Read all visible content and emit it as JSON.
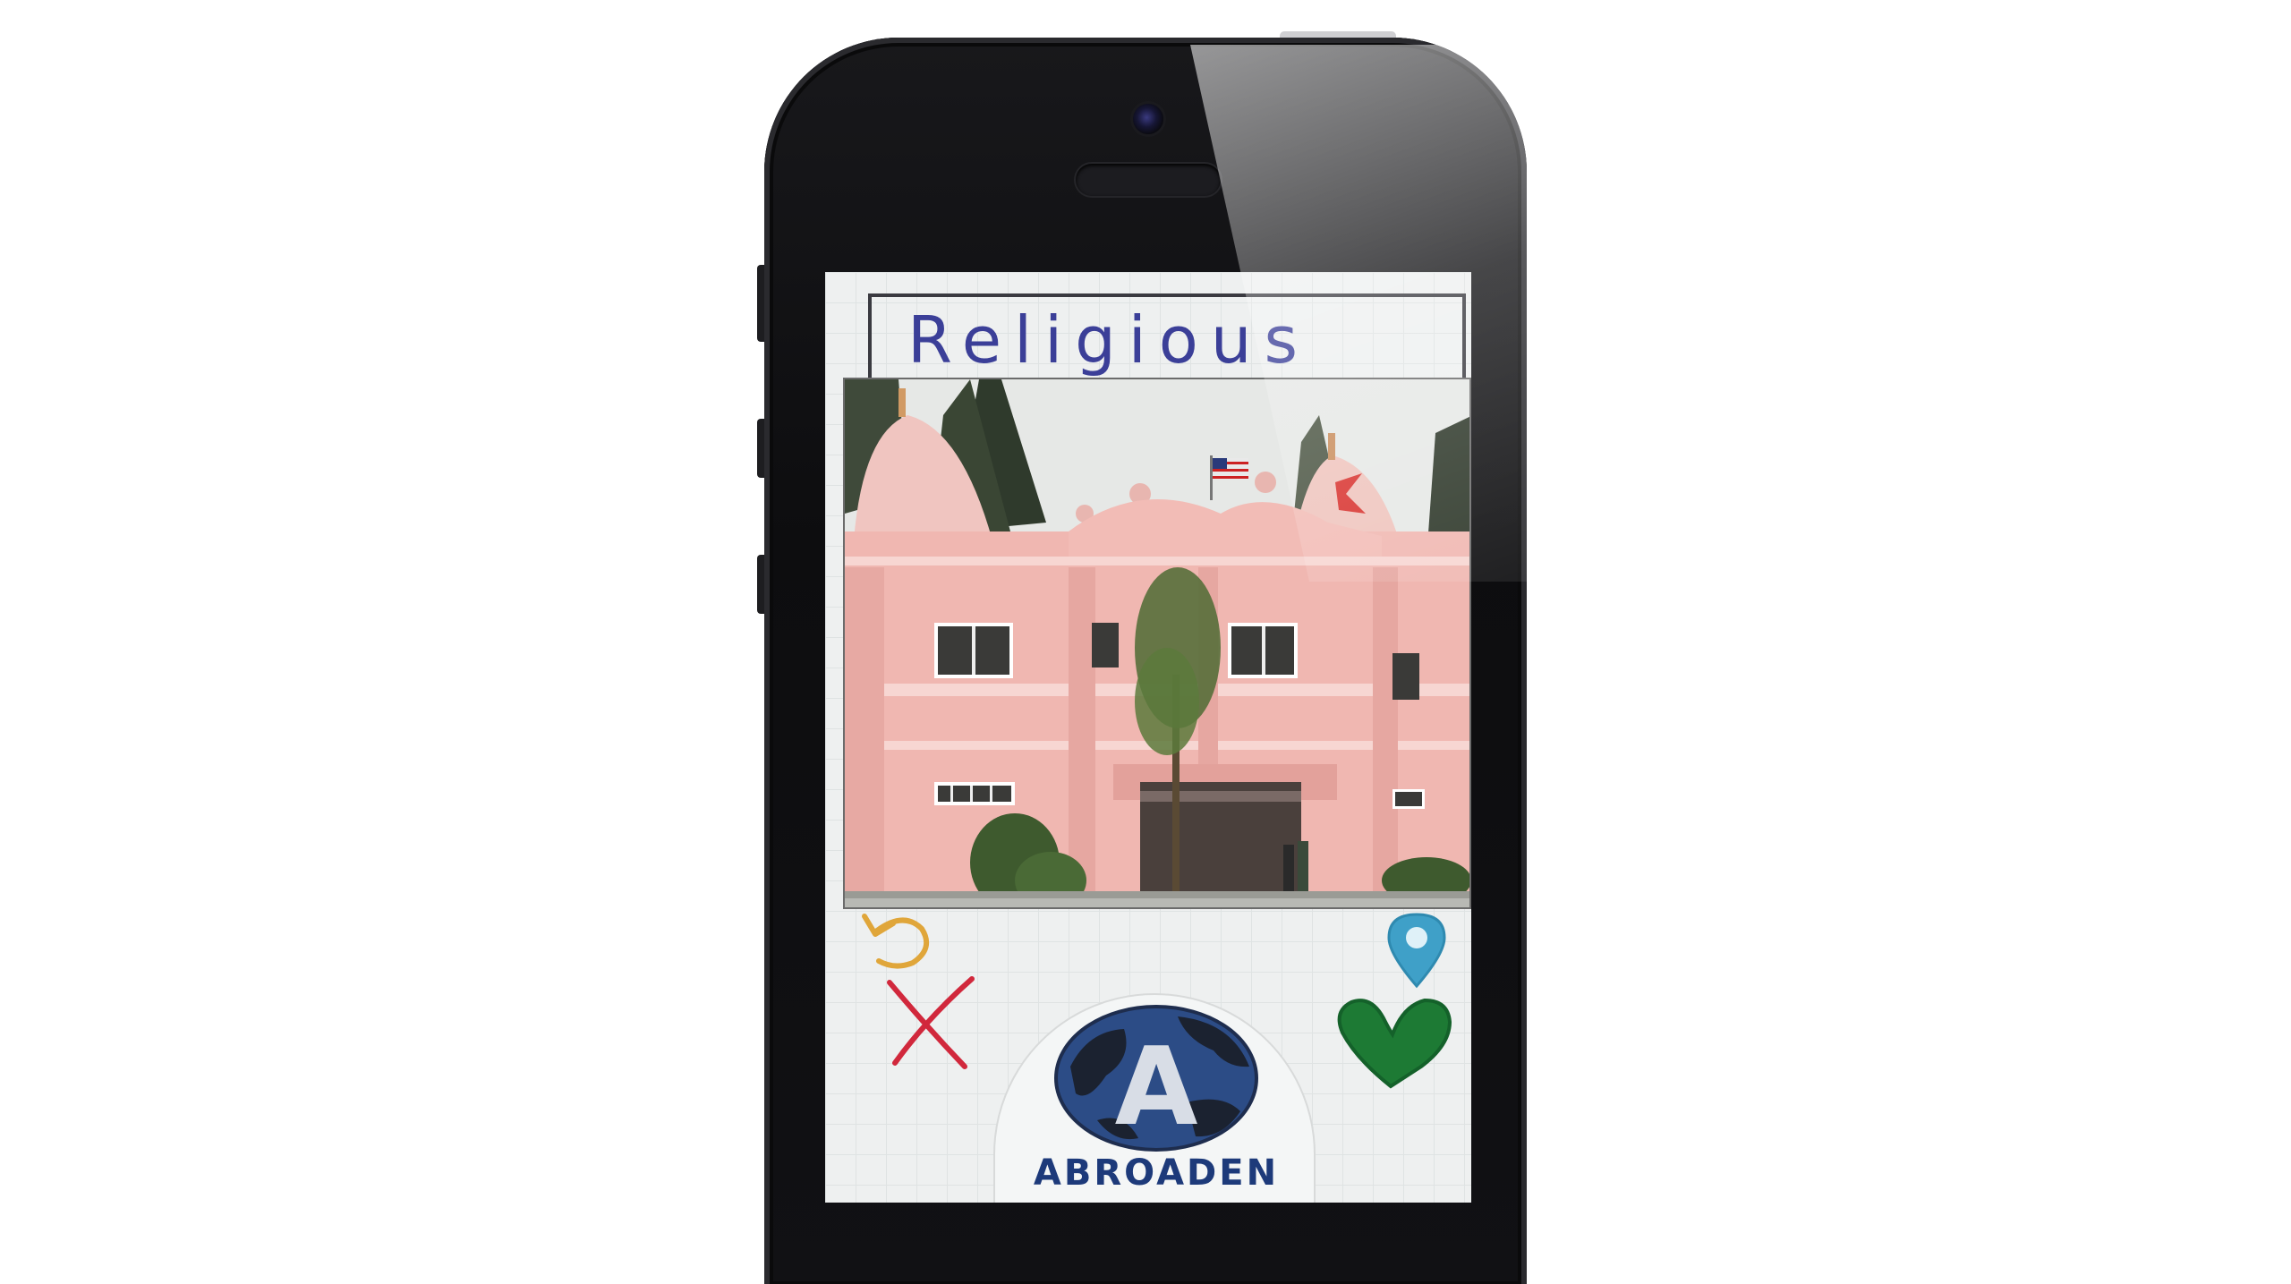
{
  "screen": {
    "category_title": "Religious",
    "photo_subject": "temple-photo",
    "actions": {
      "undo_icon": "undo-arrow-icon",
      "reject_icon": "x-mark-icon",
      "location_icon": "map-pin-icon",
      "like_icon": "heart-icon"
    },
    "logo": {
      "letter": "A",
      "name": "ABROADEN"
    }
  },
  "colors": {
    "title": "#3b3f98",
    "undo": "#e0a63a",
    "reject": "#d1283c",
    "location": "#3fa0c8",
    "like": "#1d7a34",
    "logo_text": "#1d3a7a"
  }
}
